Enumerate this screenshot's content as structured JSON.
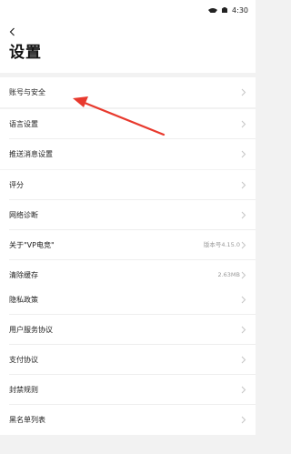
{
  "status": {
    "time": "4:30"
  },
  "header": {
    "title": "设置"
  },
  "groups": [
    {
      "items": [
        {
          "label": "账号与安全"
        }
      ]
    },
    {
      "items": [
        {
          "label": "语言设置"
        },
        {
          "label": "推送消息设置"
        }
      ]
    },
    {
      "items": [
        {
          "label": "评分"
        },
        {
          "label": "网络诊断"
        },
        {
          "label": "关于\"VP电竞\"",
          "value": "版本号4.15.0"
        },
        {
          "label": "清除缓存",
          "value": "2.63MB"
        }
      ]
    },
    {
      "items": [
        {
          "label": "隐私政策"
        },
        {
          "label": "用户服务协议"
        },
        {
          "label": "支付协议"
        },
        {
          "label": "封禁规则"
        },
        {
          "label": "黑名单列表"
        }
      ]
    }
  ],
  "colors": {
    "annotation_arrow": "#e8392d",
    "background": "#f2f2f2"
  },
  "icons": [
    "wifi-icon",
    "battery-icon",
    "back-arrow-icon",
    "chevron-right-icon"
  ]
}
